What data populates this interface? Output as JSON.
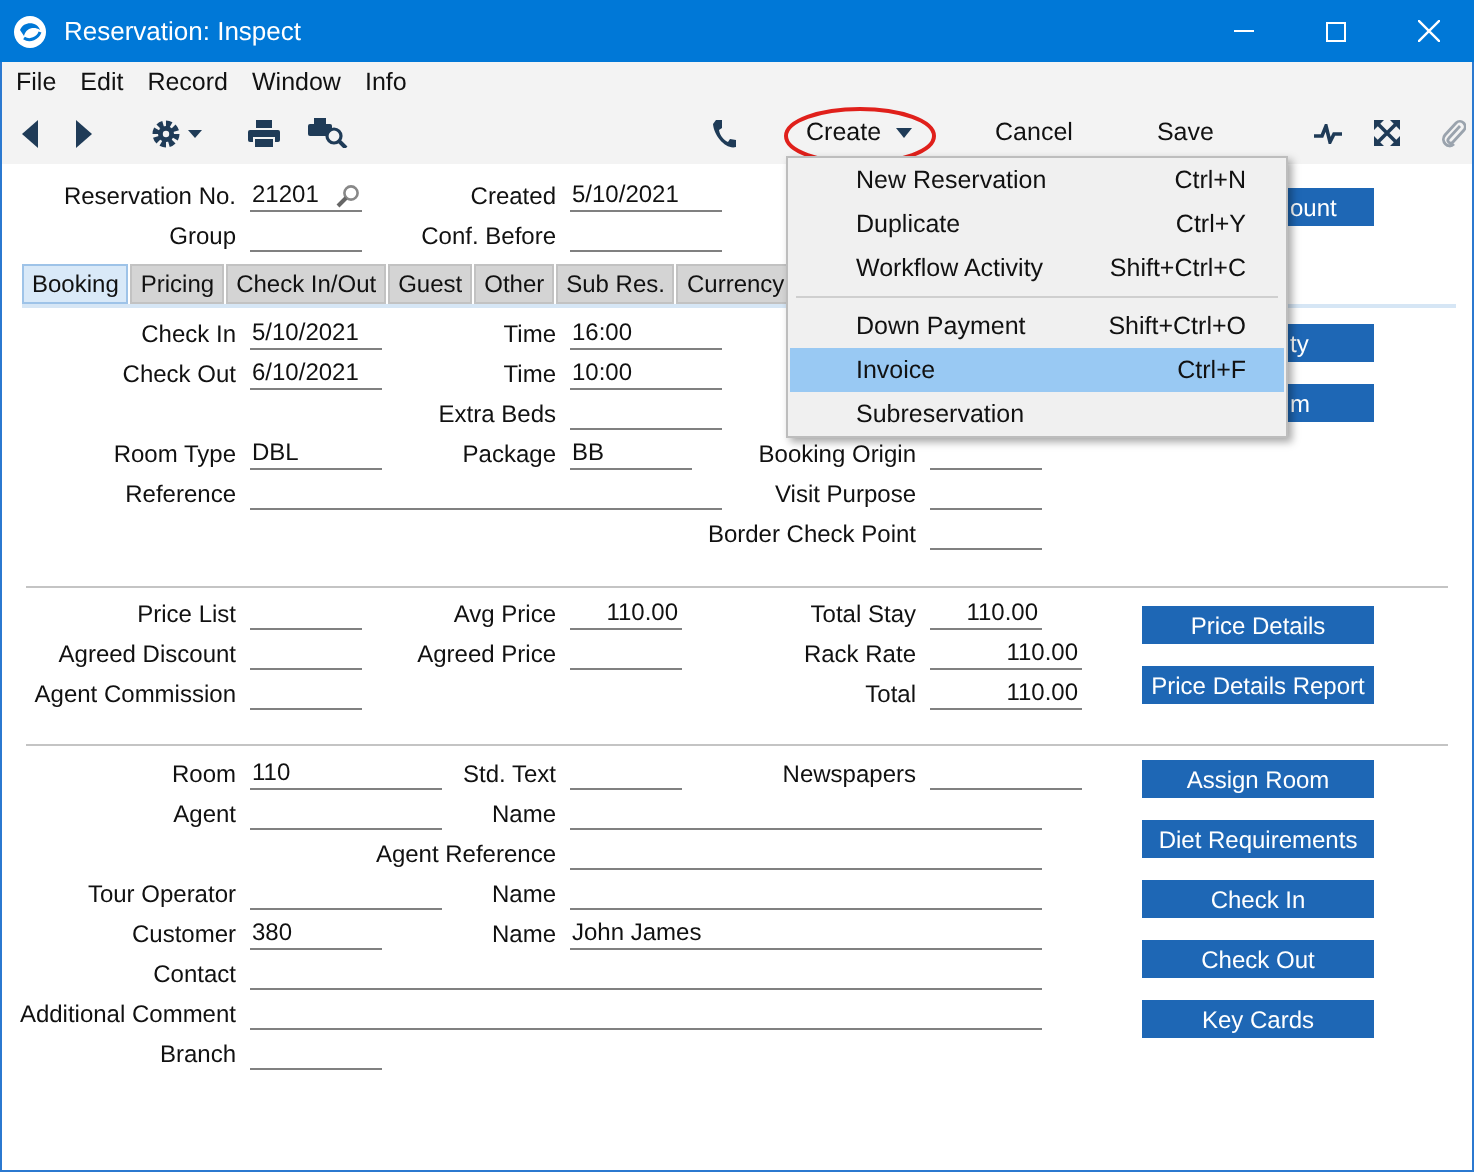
{
  "window": {
    "title": "Reservation: Inspect"
  },
  "menu_bar": [
    "File",
    "Edit",
    "Record",
    "Window",
    "Info"
  ],
  "toolbar": {
    "buttons": [
      {
        "label": "Create",
        "kind": "dropdown",
        "circled": true
      },
      {
        "label": "Cancel",
        "kind": "plain",
        "circled": false
      },
      {
        "label": "Save",
        "kind": "plain",
        "circled": false
      }
    ]
  },
  "create_menu": {
    "items": [
      {
        "kind": "item",
        "label": "New Reservation",
        "shortcut": "Ctrl+N",
        "selected": false
      },
      {
        "kind": "item",
        "label": "Duplicate",
        "shortcut": "Ctrl+Y",
        "selected": false
      },
      {
        "kind": "item",
        "label": "Workflow Activity",
        "shortcut": "Shift+Ctrl+C",
        "selected": false
      },
      {
        "kind": "separator"
      },
      {
        "kind": "item",
        "label": "Down Payment",
        "shortcut": "Shift+Ctrl+O",
        "selected": false
      },
      {
        "kind": "item",
        "label": "Invoice",
        "shortcut": "Ctrl+F",
        "selected": true
      },
      {
        "kind": "item",
        "label": "Subreservation",
        "selected": false
      }
    ]
  },
  "header": {
    "rows": [
      [
        {
          "label": "Reservation No.",
          "value": "21201"
        },
        {
          "label": "Created",
          "value": "5/10/2021"
        }
      ],
      [
        {
          "label": "Group"
        },
        {
          "label": "Conf. Before"
        }
      ]
    ],
    "buttons": [
      "ount"
    ]
  },
  "tabs": [
    {
      "label": "Booking",
      "selected": true
    },
    {
      "label": "Pricing",
      "selected": false
    },
    {
      "label": "Check In/Out",
      "selected": false
    },
    {
      "label": "Guest",
      "selected": false
    },
    {
      "label": "Other",
      "selected": false
    },
    {
      "label": "Sub Res.",
      "selected": false
    },
    {
      "label": "Currency",
      "selected": false
    }
  ],
  "booking": {
    "rows": [
      [
        {
          "label": "Check In",
          "value": "5/10/2021"
        },
        {
          "label": "Time",
          "value": "16:00"
        }
      ],
      [
        {
          "label": "Check Out",
          "value": "6/10/2021"
        },
        {
          "label": "Time",
          "value": "10:00"
        }
      ],
      [
        null,
        {
          "label": "Extra Beds"
        },
        null
      ],
      [
        {
          "label": "Room Type",
          "value": "DBL"
        },
        {
          "label": "Package",
          "value": "BB"
        },
        {
          "label": "Booking Origin"
        }
      ],
      [
        {
          "label": "Reference"
        },
        null,
        {
          "label": "Visit Purpose"
        }
      ],
      [
        null,
        null,
        {
          "label": "Border Check Point"
        }
      ]
    ],
    "buttons": [
      "ty",
      "m"
    ]
  },
  "pricing": {
    "rows": [
      [
        {
          "label": "Price List"
        },
        {
          "label": "Avg Price",
          "value": "110.00"
        },
        {
          "label": "Total Stay",
          "value": "110.00"
        }
      ],
      [
        {
          "label": "Agreed Discount"
        },
        {
          "label": "Agreed Price"
        },
        {
          "label": "Rack Rate",
          "value": "110.00"
        }
      ],
      [
        {
          "label": "Agent Commission"
        },
        null,
        {
          "label": "Total",
          "value": "110.00"
        }
      ]
    ],
    "buttons": [
      "Price Details",
      "Price Details Report"
    ]
  },
  "details": {
    "rows": [
      [
        {
          "label": "Room",
          "value": "110"
        },
        {
          "label": "Std. Text"
        },
        {
          "label": "Newspapers"
        }
      ],
      [
        {
          "label": "Agent"
        },
        {
          "label": "Name"
        }
      ],
      [
        null,
        {
          "label": "Agent Reference"
        }
      ],
      [
        {
          "label": "Tour Operator"
        },
        {
          "label": "Name"
        }
      ],
      [
        {
          "label": "Customer",
          "value": "380"
        },
        {
          "label": "Name",
          "value": "John James"
        }
      ],
      [
        {
          "label": "Contact"
        }
      ],
      [
        {
          "label": "Additional Comment"
        }
      ],
      [
        {
          "label": "Branch"
        }
      ]
    ],
    "buttons": [
      "Assign Room",
      "Diet Requirements",
      "Check In",
      "Check Out",
      "Key Cards"
    ]
  }
}
